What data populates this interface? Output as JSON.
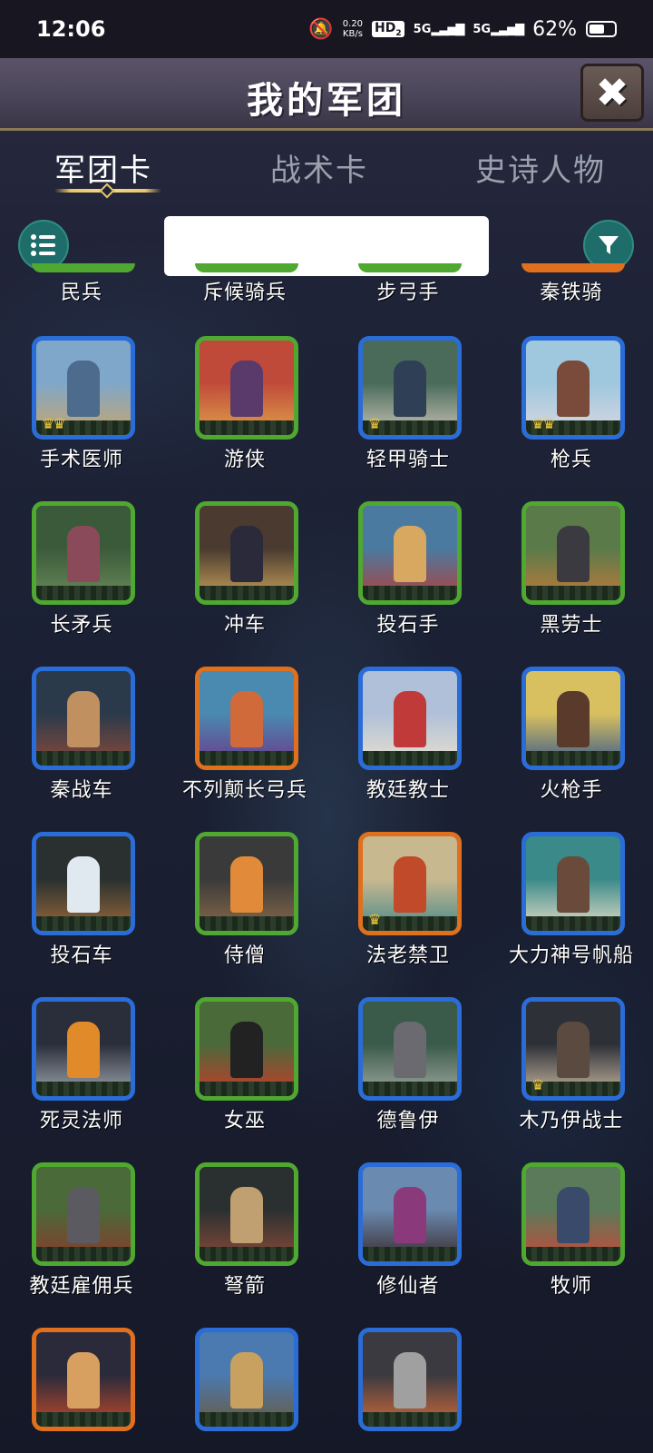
{
  "status": {
    "time": "12:06",
    "speed_value": "0.20",
    "speed_unit": "KB/s",
    "hd": "HD",
    "hd_sub": "2",
    "sig1": "5G",
    "sig2": "5G",
    "battery": "62%",
    "battery_level": 0.62
  },
  "header": {
    "title": "我的军团",
    "close_icon": "✖"
  },
  "tabs": [
    {
      "label": "军团卡",
      "active": true
    },
    {
      "label": "战术卡",
      "active": false
    },
    {
      "label": "史诗人物",
      "active": false
    }
  ],
  "toolbar": {
    "list_icon": "list-icon",
    "filter_icon": "filter-icon",
    "search_value": ""
  },
  "colors": {
    "green": "#4fa830",
    "blue": "#2a6cd8",
    "orange": "#e0701e",
    "teal_button": "#1f6d6a"
  },
  "partial_row": [
    {
      "label": "民兵",
      "rarity": "green"
    },
    {
      "label": "斥候骑兵",
      "rarity": "green"
    },
    {
      "label": "步弓手",
      "rarity": "green"
    },
    {
      "label": "秦铁骑",
      "rarity": "orange"
    }
  ],
  "cards": [
    {
      "label": "手术医师",
      "rarity": "blue",
      "crowns": 2
    },
    {
      "label": "游侠",
      "rarity": "green",
      "crowns": 0
    },
    {
      "label": "轻甲骑士",
      "rarity": "blue",
      "crowns": 1
    },
    {
      "label": "枪兵",
      "rarity": "blue",
      "crowns": 2
    },
    {
      "label": "长矛兵",
      "rarity": "green",
      "crowns": 0
    },
    {
      "label": "冲车",
      "rarity": "green",
      "crowns": 0
    },
    {
      "label": "投石手",
      "rarity": "green",
      "crowns": 0
    },
    {
      "label": "黑劳士",
      "rarity": "green",
      "crowns": 0
    },
    {
      "label": "秦战车",
      "rarity": "blue",
      "crowns": 0
    },
    {
      "label": "不列颠长弓兵",
      "rarity": "orange",
      "crowns": 0
    },
    {
      "label": "教廷教士",
      "rarity": "blue",
      "crowns": 0
    },
    {
      "label": "火枪手",
      "rarity": "blue",
      "crowns": 0
    },
    {
      "label": "投石车",
      "rarity": "blue",
      "crowns": 0
    },
    {
      "label": "侍僧",
      "rarity": "green",
      "crowns": 0
    },
    {
      "label": "法老禁卫",
      "rarity": "orange",
      "crowns": 1
    },
    {
      "label": "大力神号帆船",
      "rarity": "blue",
      "crowns": 0
    },
    {
      "label": "死灵法师",
      "rarity": "blue",
      "crowns": 0
    },
    {
      "label": "女巫",
      "rarity": "green",
      "crowns": 0
    },
    {
      "label": "德鲁伊",
      "rarity": "blue",
      "crowns": 0
    },
    {
      "label": "木乃伊战士",
      "rarity": "blue",
      "crowns": 1
    },
    {
      "label": "教廷雇佣兵",
      "rarity": "green",
      "crowns": 0
    },
    {
      "label": "弩箭",
      "rarity": "green",
      "crowns": 0
    },
    {
      "label": "修仙者",
      "rarity": "blue",
      "crowns": 0
    },
    {
      "label": "牧师",
      "rarity": "green",
      "crowns": 0
    },
    {
      "label": "",
      "rarity": "orange",
      "crowns": 0
    },
    {
      "label": "",
      "rarity": "blue",
      "crowns": 0
    },
    {
      "label": "",
      "rarity": "blue",
      "crowns": 0
    }
  ]
}
